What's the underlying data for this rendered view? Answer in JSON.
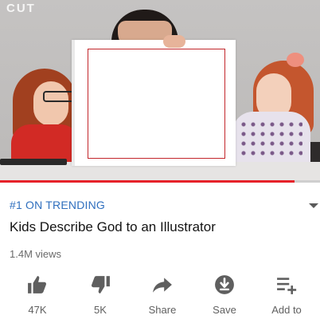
{
  "video": {
    "channel_logo": "CUT",
    "progress_fraction": 0.92
  },
  "meta": {
    "trending": "#1 ON TRENDING",
    "title": "Kids Describe God to an Illustrator",
    "views": "1.4M views"
  },
  "actions": [
    {
      "label": "47K",
      "icon": "thumbs-up-icon"
    },
    {
      "label": "5K",
      "icon": "thumbs-down-icon"
    },
    {
      "label": "Share",
      "icon": "share-icon"
    },
    {
      "label": "Save",
      "icon": "save-download-icon"
    },
    {
      "label": "Add to",
      "icon": "add-to-playlist-icon"
    }
  ],
  "colors": {
    "trending": "#2f6fbe",
    "progress": "#e6222a",
    "icon": "#5f5f5f"
  }
}
